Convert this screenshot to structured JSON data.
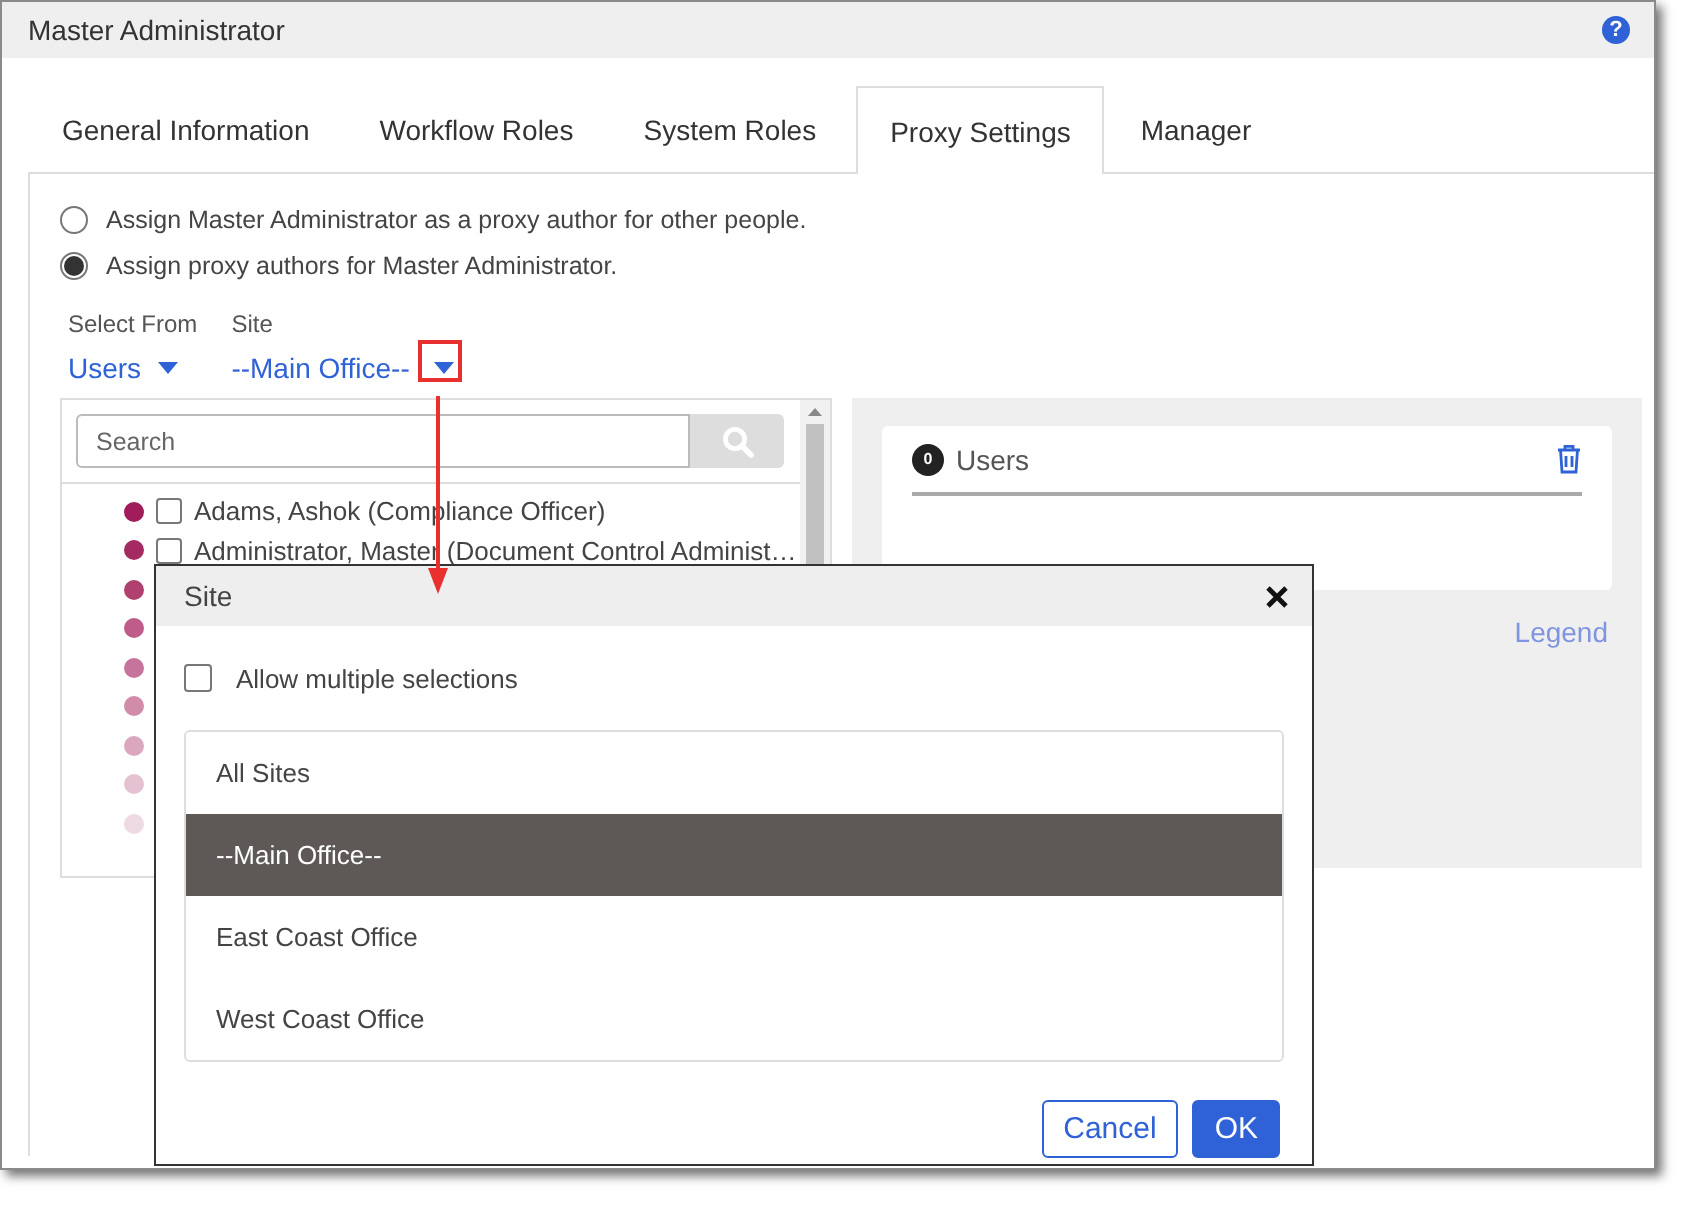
{
  "window": {
    "title": "Master Administrator",
    "help": "?"
  },
  "tabs": [
    {
      "label": "General Information",
      "selected": false
    },
    {
      "label": "Workflow Roles",
      "selected": false
    },
    {
      "label": "System Roles",
      "selected": false
    },
    {
      "label": "Proxy Settings",
      "selected": true
    },
    {
      "label": "Manager",
      "selected": false
    }
  ],
  "proxy_mode": [
    {
      "label": "Assign Master Administrator as a proxy author for other people.",
      "selected": false
    },
    {
      "label": "Assign proxy authors for Master Administrator.",
      "selected": true
    }
  ],
  "select_from": {
    "label": "Select From",
    "value": "Users"
  },
  "site": {
    "label": "Site",
    "value": "--Main Office--"
  },
  "search": {
    "placeholder": "Search"
  },
  "users": [
    {
      "name": "Adams, Ashok (Compliance Officer)",
      "checked": false,
      "color": "#a01c5a"
    },
    {
      "name": "Administrator, Master (Document Control Administ…",
      "checked": false,
      "color": "#a52a62"
    },
    {
      "color": "#b0406f"
    },
    {
      "color": "#bf5c8a"
    },
    {
      "color": "#c7749c"
    },
    {
      "color": "#d08ca9"
    },
    {
      "color": "#daa7bf"
    },
    {
      "color": "#e5c2d1"
    },
    {
      "color": "#efd9e2"
    }
  ],
  "selected_panel": {
    "count": "0",
    "title": "Users"
  },
  "legend": "Legend",
  "site_dialog": {
    "title": "Site",
    "allow_multiple": {
      "label": "Allow multiple selections",
      "checked": false
    },
    "sites": [
      {
        "label": "All Sites",
        "selected": false
      },
      {
        "label": "--Main Office--",
        "selected": true
      },
      {
        "label": "East Coast Office",
        "selected": false
      },
      {
        "label": "West Coast Office",
        "selected": false
      }
    ],
    "buttons": [
      {
        "label": "Cancel",
        "kind": "secondary"
      },
      {
        "label": "OK",
        "kind": "primary"
      }
    ]
  }
}
